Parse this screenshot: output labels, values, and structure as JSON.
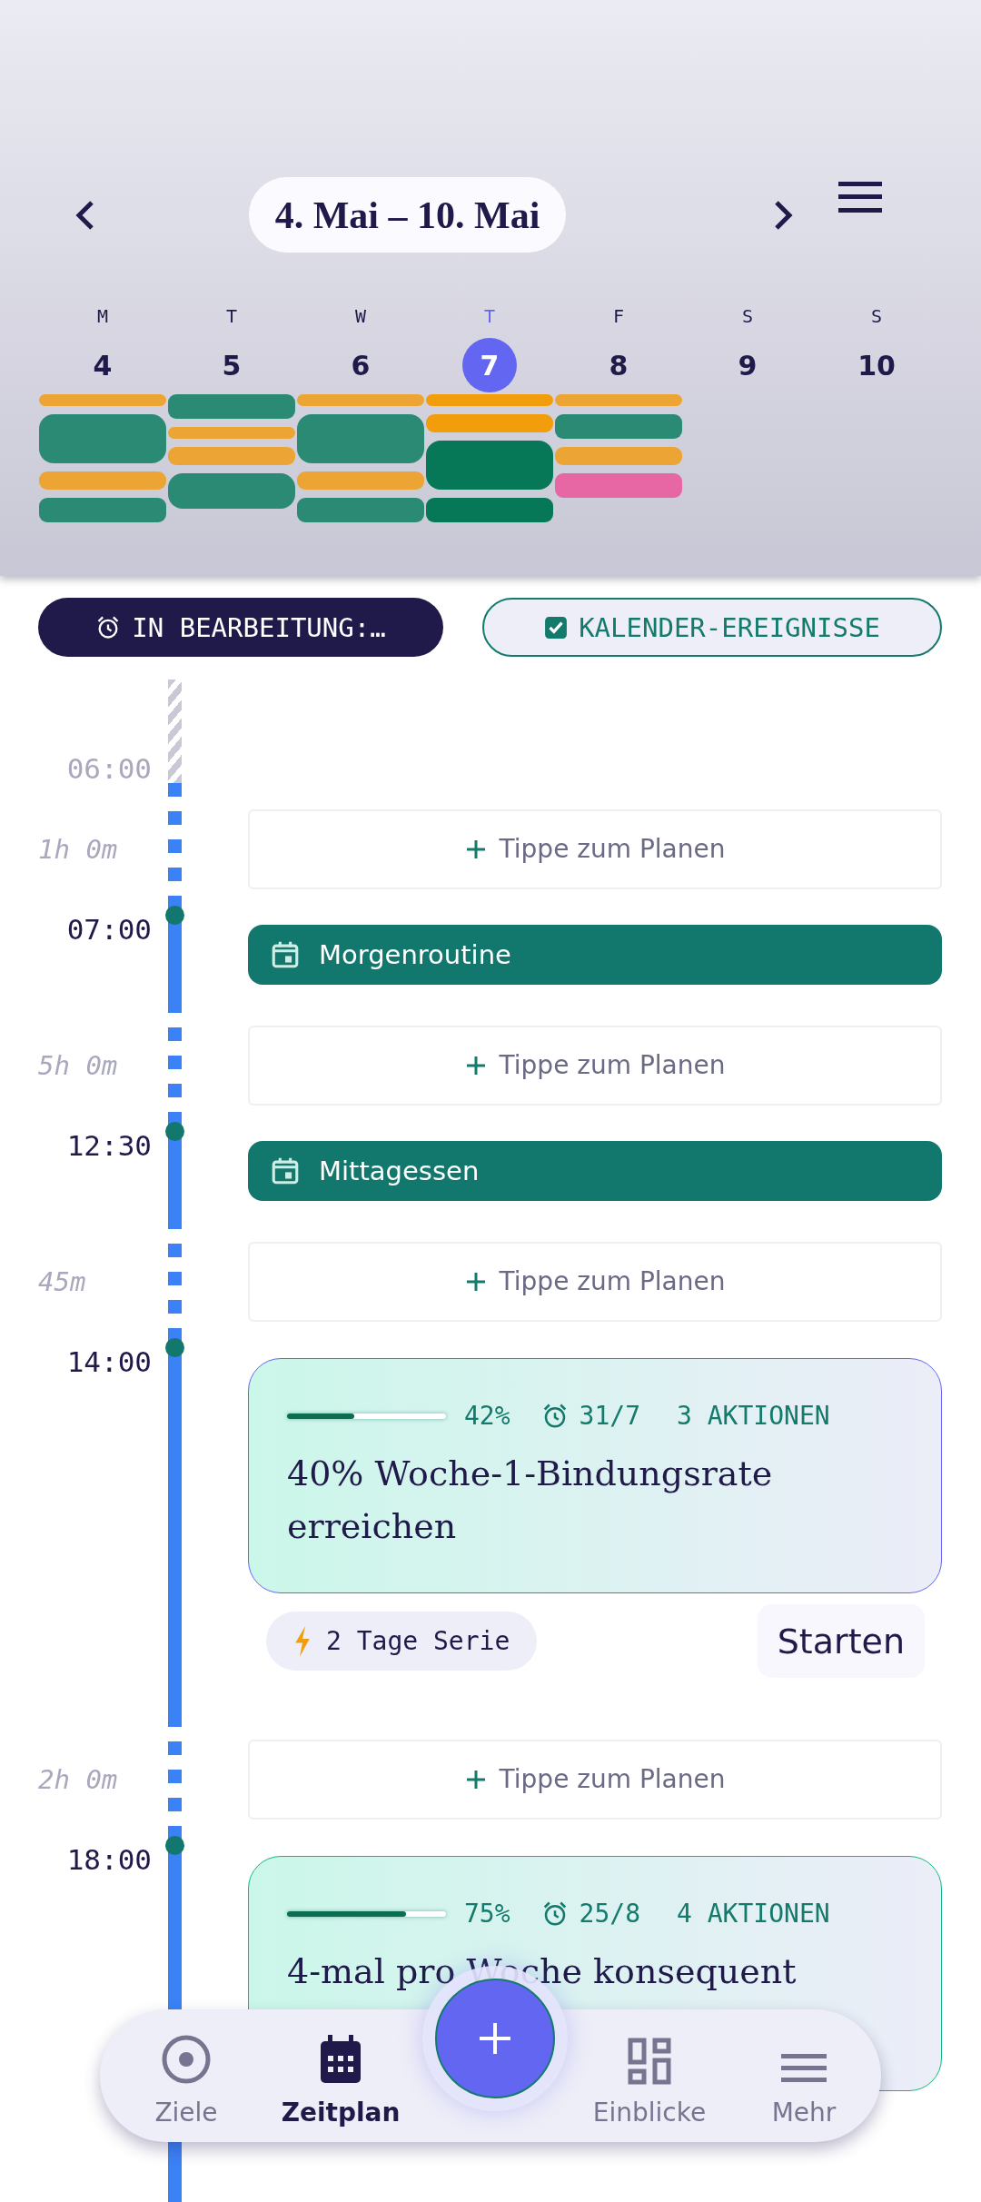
{
  "header": {
    "title": "4. Mai – 10. Mai",
    "days": [
      {
        "weekday": "M",
        "date": "4",
        "selected": false,
        "events": [
          {
            "kind": "thin",
            "color": "#eca534"
          },
          {
            "kind": "xl",
            "color": "#2b8a73"
          },
          {
            "kind": "small",
            "color": "#eca534"
          },
          {
            "kind": "medium",
            "color": "#2b8a73"
          }
        ]
      },
      {
        "weekday": "T",
        "date": "5",
        "selected": false,
        "events": [
          {
            "kind": "medium",
            "color": "#2b8a73"
          },
          {
            "kind": "thin",
            "color": "#eca534"
          },
          {
            "kind": "small",
            "color": "#eca534"
          },
          {
            "kind": "large",
            "color": "#2b8a73"
          }
        ]
      },
      {
        "weekday": "W",
        "date": "6",
        "selected": false,
        "events": [
          {
            "kind": "thin",
            "color": "#eca534"
          },
          {
            "kind": "xl",
            "color": "#2b8a73"
          },
          {
            "kind": "small",
            "color": "#eca534"
          },
          {
            "kind": "medium",
            "color": "#2b8a73"
          }
        ]
      },
      {
        "weekday": "T",
        "date": "7",
        "selected": true,
        "events": [
          {
            "kind": "thin",
            "color": "#f29e0c"
          },
          {
            "kind": "small",
            "color": "#f29e0c"
          },
          {
            "kind": "xl",
            "color": "#067857"
          },
          {
            "kind": "medium",
            "color": "#067857"
          }
        ]
      },
      {
        "weekday": "F",
        "date": "8",
        "selected": false,
        "events": [
          {
            "kind": "thin",
            "color": "#eca534"
          },
          {
            "kind": "medium",
            "color": "#2b8a73"
          },
          {
            "kind": "small",
            "color": "#eca534"
          },
          {
            "kind": "medium",
            "color": "#e766a4"
          }
        ]
      },
      {
        "weekday": "S",
        "date": "9",
        "selected": false
      },
      {
        "weekday": "S",
        "date": "10",
        "selected": false
      }
    ]
  },
  "filters": [
    {
      "kind": "status",
      "label": "IN BEARBEITUNG:…"
    },
    {
      "kind": "toggle",
      "label": "KALENDER-EREIGNISSE",
      "checked": true
    }
  ],
  "timeline": [
    {
      "kind": "start",
      "time": "06:00"
    },
    {
      "kind": "slot",
      "duration": "1h 0m",
      "label": "Tippe zum Planen"
    },
    {
      "kind": "event",
      "time": "07:00",
      "title": "Morgenroutine"
    },
    {
      "kind": "slot",
      "duration": "5h 0m",
      "label": "Tippe zum Planen"
    },
    {
      "kind": "event",
      "time": "12:30",
      "title": "Mittagessen"
    },
    {
      "kind": "slot",
      "duration": "45m",
      "label": "Tippe zum Planen"
    },
    {
      "kind": "goal",
      "time": "14:00",
      "color": "#6366f1",
      "level": 0.42,
      "percent": "42%",
      "deadline": "31/7",
      "actions": "3 AKTIONEN",
      "title": "40% Woche-1-Bindungsrate erreichen",
      "streak": "2 Tage Serie",
      "button": "Starten"
    },
    {
      "kind": "slot",
      "duration": "2h 0m",
      "label": "Tippe zum Planen"
    },
    {
      "kind": "goal",
      "time": "18:00",
      "color": "#10b981",
      "level": 0.75,
      "percent": "75%",
      "deadline": "25/8",
      "actions": "4 AKTIONEN",
      "title": "4-mal pro Woche konsequent"
    }
  ],
  "nav": [
    {
      "kind": "target",
      "label": "Ziele",
      "selected": false
    },
    {
      "kind": "calendar",
      "label": "Zeitplan",
      "selected": true
    },
    {
      "kind": "add"
    },
    {
      "kind": "dashboard",
      "label": "Einblicke",
      "selected": false
    },
    {
      "kind": "menu",
      "label": "Mehr",
      "selected": false
    }
  ]
}
